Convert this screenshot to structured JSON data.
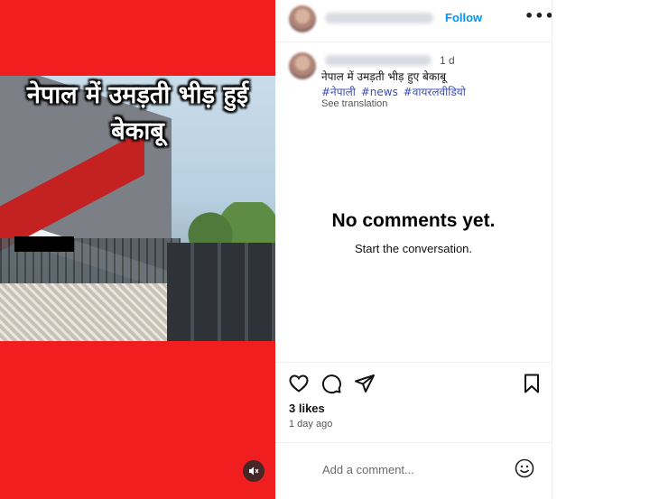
{
  "media": {
    "overlay_line1": "नेपाल में उमड़ती भीड़ हुई",
    "overlay_line2": "बेकाबू",
    "background_color": "#f01e1e",
    "mute_icon": "speaker-muted-icon"
  },
  "header": {
    "follow_label": "Follow",
    "more_label": "•••"
  },
  "post": {
    "time": "1 d",
    "caption": "नेपाल में उमड़ती भीड़ हुए बेकाबू",
    "hashtags": [
      "#नेपाली",
      "#news",
      "#वायरलवीडियो"
    ],
    "see_translation": "See translation"
  },
  "comments": {
    "empty_title": "No comments yet.",
    "empty_subtitle": "Start the conversation."
  },
  "actions": {
    "icons": [
      "heart-icon",
      "comment-icon",
      "share-icon",
      "bookmark-icon"
    ],
    "likes": "3 likes",
    "posted_ago": "1 day ago"
  },
  "comment_box": {
    "placeholder": "Add a comment...",
    "emoji_icon": "smiley-icon"
  },
  "colors": {
    "accent": "#0095f6",
    "hashtag": "#3b4fb3"
  }
}
